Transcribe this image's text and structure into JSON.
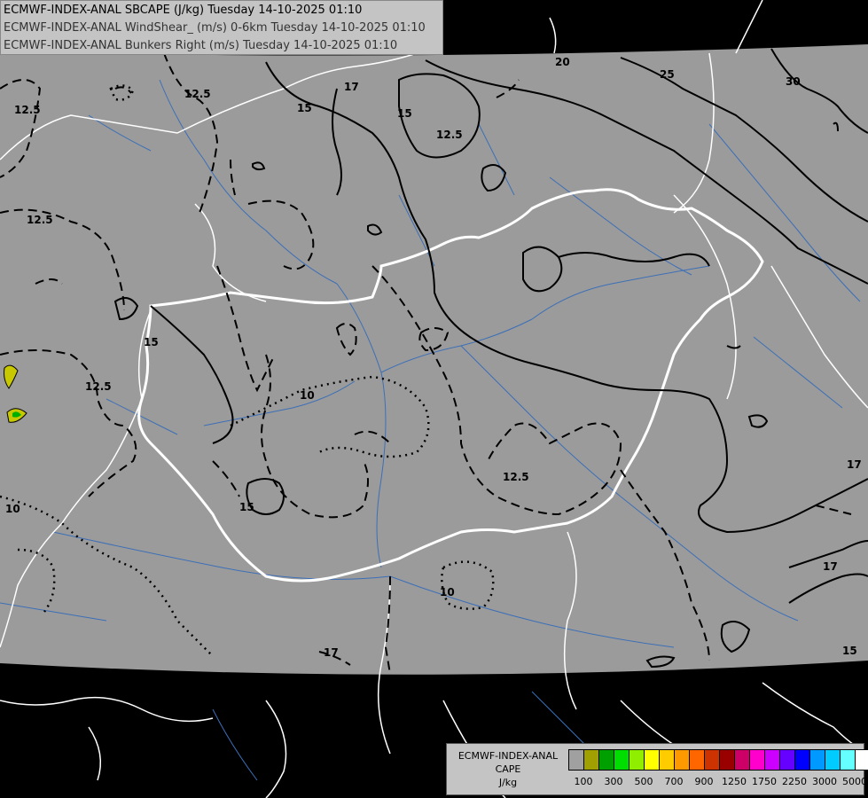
{
  "titles": {
    "line1": "ECMWF-INDEX-ANAL SBCAPE (J/kg) Tuesday 14-10-2025 01:10",
    "line2": "ECMWF-INDEX-ANAL WindShear_ (m/s) 0-6km Tuesday 14-10-2025 01:10",
    "line3": "ECMWF-INDEX-ANAL Bunkers Right (m/s) Tuesday 14-10-2025 01:10"
  },
  "legend": {
    "line1": "ECMWF-INDEX-ANAL",
    "line2": "CAPE",
    "line3": "J/kg",
    "colors": [
      "#a0a0a0",
      "#a0a000",
      "#00a000",
      "#00dd00",
      "#90ee00",
      "#ffff00",
      "#ffcc00",
      "#ff9900",
      "#ff6600",
      "#cc3300",
      "#990000",
      "#cc0066",
      "#ff00cc",
      "#cc00ff",
      "#6600ff",
      "#0000ff",
      "#0099ff",
      "#00ccff",
      "#66ffff",
      "#ffffff"
    ],
    "tick_labels": [
      "100",
      "300",
      "500",
      "700",
      "900",
      "1250",
      "1750",
      "2250",
      "3000",
      "5000"
    ]
  },
  "contour_labels": {
    "l30": "30",
    "l25": "25",
    "l20": "20",
    "l17a": "17",
    "l15a": "15",
    "l15b": "15",
    "l125a": "12.5",
    "l125b": "12.5",
    "l125c": "12.5",
    "l125d": "12.5",
    "l125e": "12.5",
    "l15c": "15",
    "l10a": "10",
    "l15d": "15",
    "l125f": "12.5",
    "l10b": "10",
    "l10c": "10",
    "l17b": "17",
    "l17c": "17",
    "l15e": "15",
    "l17d": "17"
  }
}
